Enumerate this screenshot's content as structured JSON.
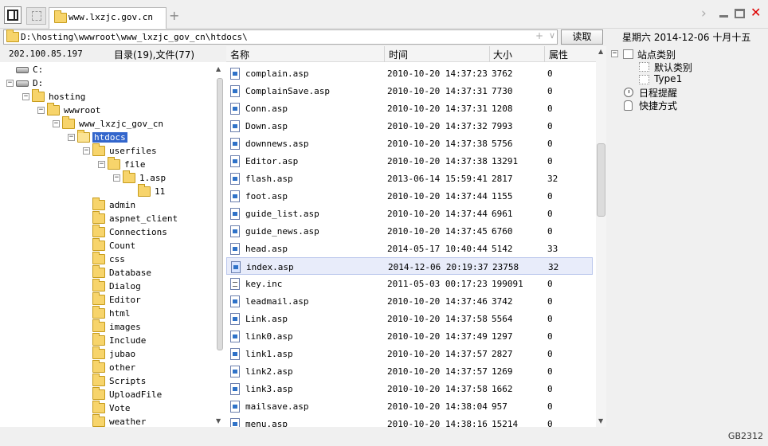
{
  "tab": {
    "title": "www.lxzjc.gov.cn"
  },
  "address": {
    "path": "D:\\hosting\\wwwroot\\www_lxzjc_gov_cn\\htdocs\\",
    "plus": "+",
    "dropdown": "∨",
    "read_button": "读取"
  },
  "date": "星期六 2014-12-06 十月十五",
  "left": {
    "ip": "202.100.85.197",
    "count": "目录(19),文件(77)"
  },
  "tree": [
    {
      "label": "C:",
      "icon": "drive-icon",
      "exp": ""
    },
    {
      "label": "D:",
      "icon": "drive-icon",
      "exp": "−"
    },
    {
      "label": "hosting",
      "icon": "folder-icon",
      "exp": "−"
    },
    {
      "label": "wwwroot",
      "icon": "folder-icon",
      "exp": "−"
    },
    {
      "label": "www_lxzjc_gov_cn",
      "icon": "folder-icon",
      "exp": "−"
    },
    {
      "label": "htdocs",
      "icon": "folder-open-icon",
      "exp": "−",
      "selected": true
    },
    {
      "label": "userfiles",
      "icon": "folder-icon",
      "exp": "−"
    },
    {
      "label": "file",
      "icon": "folder-icon",
      "exp": "−"
    },
    {
      "label": "1.asp",
      "icon": "folder-icon",
      "exp": "−"
    },
    {
      "label": "11",
      "icon": "folder-icon",
      "exp": ""
    },
    {
      "label": "admin",
      "icon": "folder-icon",
      "exp": ""
    },
    {
      "label": "aspnet_client",
      "icon": "folder-icon",
      "exp": ""
    },
    {
      "label": "Connections",
      "icon": "folder-icon",
      "exp": ""
    },
    {
      "label": "Count",
      "icon": "folder-icon",
      "exp": ""
    },
    {
      "label": "css",
      "icon": "folder-icon",
      "exp": ""
    },
    {
      "label": "Database",
      "icon": "folder-icon",
      "exp": ""
    },
    {
      "label": "Dialog",
      "icon": "folder-icon",
      "exp": ""
    },
    {
      "label": "Editor",
      "icon": "folder-icon",
      "exp": ""
    },
    {
      "label": "html",
      "icon": "folder-icon",
      "exp": ""
    },
    {
      "label": "images",
      "icon": "folder-icon",
      "exp": ""
    },
    {
      "label": "Include",
      "icon": "folder-icon",
      "exp": ""
    },
    {
      "label": "jubao",
      "icon": "folder-icon",
      "exp": ""
    },
    {
      "label": "other",
      "icon": "folder-icon",
      "exp": ""
    },
    {
      "label": "Scripts",
      "icon": "folder-icon",
      "exp": ""
    },
    {
      "label": "UploadFile",
      "icon": "folder-icon",
      "exp": ""
    },
    {
      "label": "Vote",
      "icon": "folder-icon",
      "exp": ""
    },
    {
      "label": "weather",
      "icon": "folder-icon",
      "exp": ""
    }
  ],
  "columns": {
    "name": "名称",
    "time": "时间",
    "size": "大小",
    "attr": "属性"
  },
  "files": [
    {
      "name": "complain.asp",
      "time": "2010-10-20 14:37:23",
      "size": "3762",
      "attr": "0",
      "icon": "asp-file-icon"
    },
    {
      "name": "ComplainSave.asp",
      "time": "2010-10-20 14:37:31",
      "size": "7730",
      "attr": "0",
      "icon": "asp-file-icon"
    },
    {
      "name": "Conn.asp",
      "time": "2010-10-20 14:37:31",
      "size": "1208",
      "attr": "0",
      "icon": "asp-file-icon"
    },
    {
      "name": "Down.asp",
      "time": "2010-10-20 14:37:32",
      "size": "7993",
      "attr": "0",
      "icon": "asp-file-icon"
    },
    {
      "name": "downnews.asp",
      "time": "2010-10-20 14:37:38",
      "size": "5756",
      "attr": "0",
      "icon": "asp-file-icon"
    },
    {
      "name": "Editor.asp",
      "time": "2010-10-20 14:37:38",
      "size": "13291",
      "attr": "0",
      "icon": "asp-file-icon"
    },
    {
      "name": "flash.asp",
      "time": "2013-06-14 15:59:41",
      "size": "2817",
      "attr": "32",
      "icon": "asp-file-icon"
    },
    {
      "name": "foot.asp",
      "time": "2010-10-20 14:37:44",
      "size": "1155",
      "attr": "0",
      "icon": "asp-file-icon"
    },
    {
      "name": "guide_list.asp",
      "time": "2010-10-20 14:37:44",
      "size": "6961",
      "attr": "0",
      "icon": "asp-file-icon"
    },
    {
      "name": "guide_news.asp",
      "time": "2010-10-20 14:37:45",
      "size": "6760",
      "attr": "0",
      "icon": "asp-file-icon"
    },
    {
      "name": "head.asp",
      "time": "2014-05-17 10:40:44",
      "size": "5142",
      "attr": "33",
      "icon": "asp-file-icon"
    },
    {
      "name": "index.asp",
      "time": "2014-12-06 20:19:37",
      "size": "23758",
      "attr": "32",
      "icon": "asp-file-icon",
      "selected": true
    },
    {
      "name": "key.inc",
      "time": "2011-05-03 00:17:23",
      "size": "199091",
      "attr": "0",
      "icon": "inc-file-icon"
    },
    {
      "name": "leadmail.asp",
      "time": "2010-10-20 14:37:46",
      "size": "3742",
      "attr": "0",
      "icon": "asp-file-icon"
    },
    {
      "name": "Link.asp",
      "time": "2010-10-20 14:37:58",
      "size": "5564",
      "attr": "0",
      "icon": "asp-file-icon"
    },
    {
      "name": "link0.asp",
      "time": "2010-10-20 14:37:49",
      "size": "1297",
      "attr": "0",
      "icon": "asp-file-icon"
    },
    {
      "name": "link1.asp",
      "time": "2010-10-20 14:37:57",
      "size": "2827",
      "attr": "0",
      "icon": "asp-file-icon"
    },
    {
      "name": "link2.asp",
      "time": "2010-10-20 14:37:57",
      "size": "1269",
      "attr": "0",
      "icon": "asp-file-icon"
    },
    {
      "name": "link3.asp",
      "time": "2010-10-20 14:37:58",
      "size": "1662",
      "attr": "0",
      "icon": "asp-file-icon"
    },
    {
      "name": "mailsave.asp",
      "time": "2010-10-20 14:38:04",
      "size": "957",
      "attr": "0",
      "icon": "asp-file-icon"
    },
    {
      "name": "menu.asp",
      "time": "2010-10-20 14:38:16",
      "size": "15214",
      "attr": "0",
      "icon": "asp-file-icon"
    }
  ],
  "right": {
    "items": [
      {
        "label": "站点类别",
        "exp": "−",
        "icon": "box-icon"
      },
      {
        "label": "默认类别",
        "exp": "",
        "icon": "dotted-box-icon"
      },
      {
        "label": "Type1",
        "exp": "",
        "icon": "dotted-box-icon"
      },
      {
        "label": "日程提醒",
        "exp": "",
        "icon": "clock-icon"
      },
      {
        "label": "快捷方式",
        "exp": "",
        "icon": "hand-icon"
      }
    ]
  },
  "status": {
    "encoding": "GB2312"
  }
}
